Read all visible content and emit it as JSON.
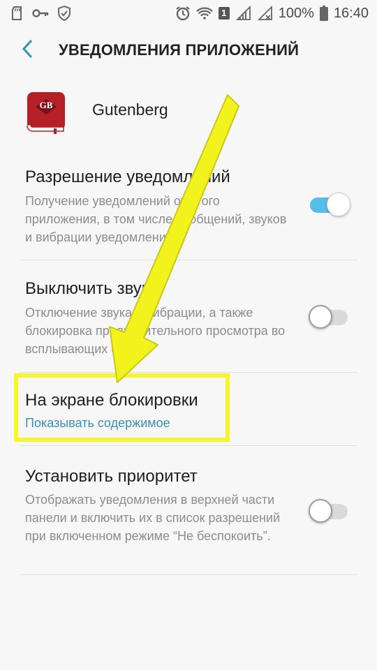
{
  "status_bar": {
    "battery_label": "100%",
    "time": "16:40",
    "sim_badge": "1",
    "icons": [
      "sd-card-icon",
      "key-icon",
      "shield-check-icon",
      "alarm-icon",
      "wifi-icon",
      "sim-badge-icon",
      "signal-icon",
      "no-signal-icon",
      "battery-icon"
    ]
  },
  "header": {
    "title": "УВЕДОМЛЕНИЯ ПРИЛОЖЕНИЙ",
    "back_icon": "chevron-left-icon",
    "accent_color": "#3b8fb4"
  },
  "app": {
    "name": "Gutenberg",
    "icon_text": "GB",
    "icon_color": "#b42026"
  },
  "settings": [
    {
      "title": "Разрешение уведомлений",
      "desc": "Получение уведомлений от этого приложения, в том числе сообщений, звуков и вибрации уведомлений.",
      "toggle": "on"
    },
    {
      "title": "Выключить звук",
      "desc": "Отключение звука и вибрации, а также блокировка предварительного просмотра во всплывающих окнах.",
      "toggle": "off"
    },
    {
      "title": "На экране блокировки",
      "sub": "Показывать содержимое"
    },
    {
      "title": "Установить приоритет",
      "desc": "Отображать уведомления в верхней части панели и включить их в список разрешений при включенном режиме “Не беспокоить”.",
      "toggle": "off"
    }
  ],
  "annotation": {
    "highlight_color": "#f7f52a",
    "arrow_color": "#f2f21c"
  }
}
